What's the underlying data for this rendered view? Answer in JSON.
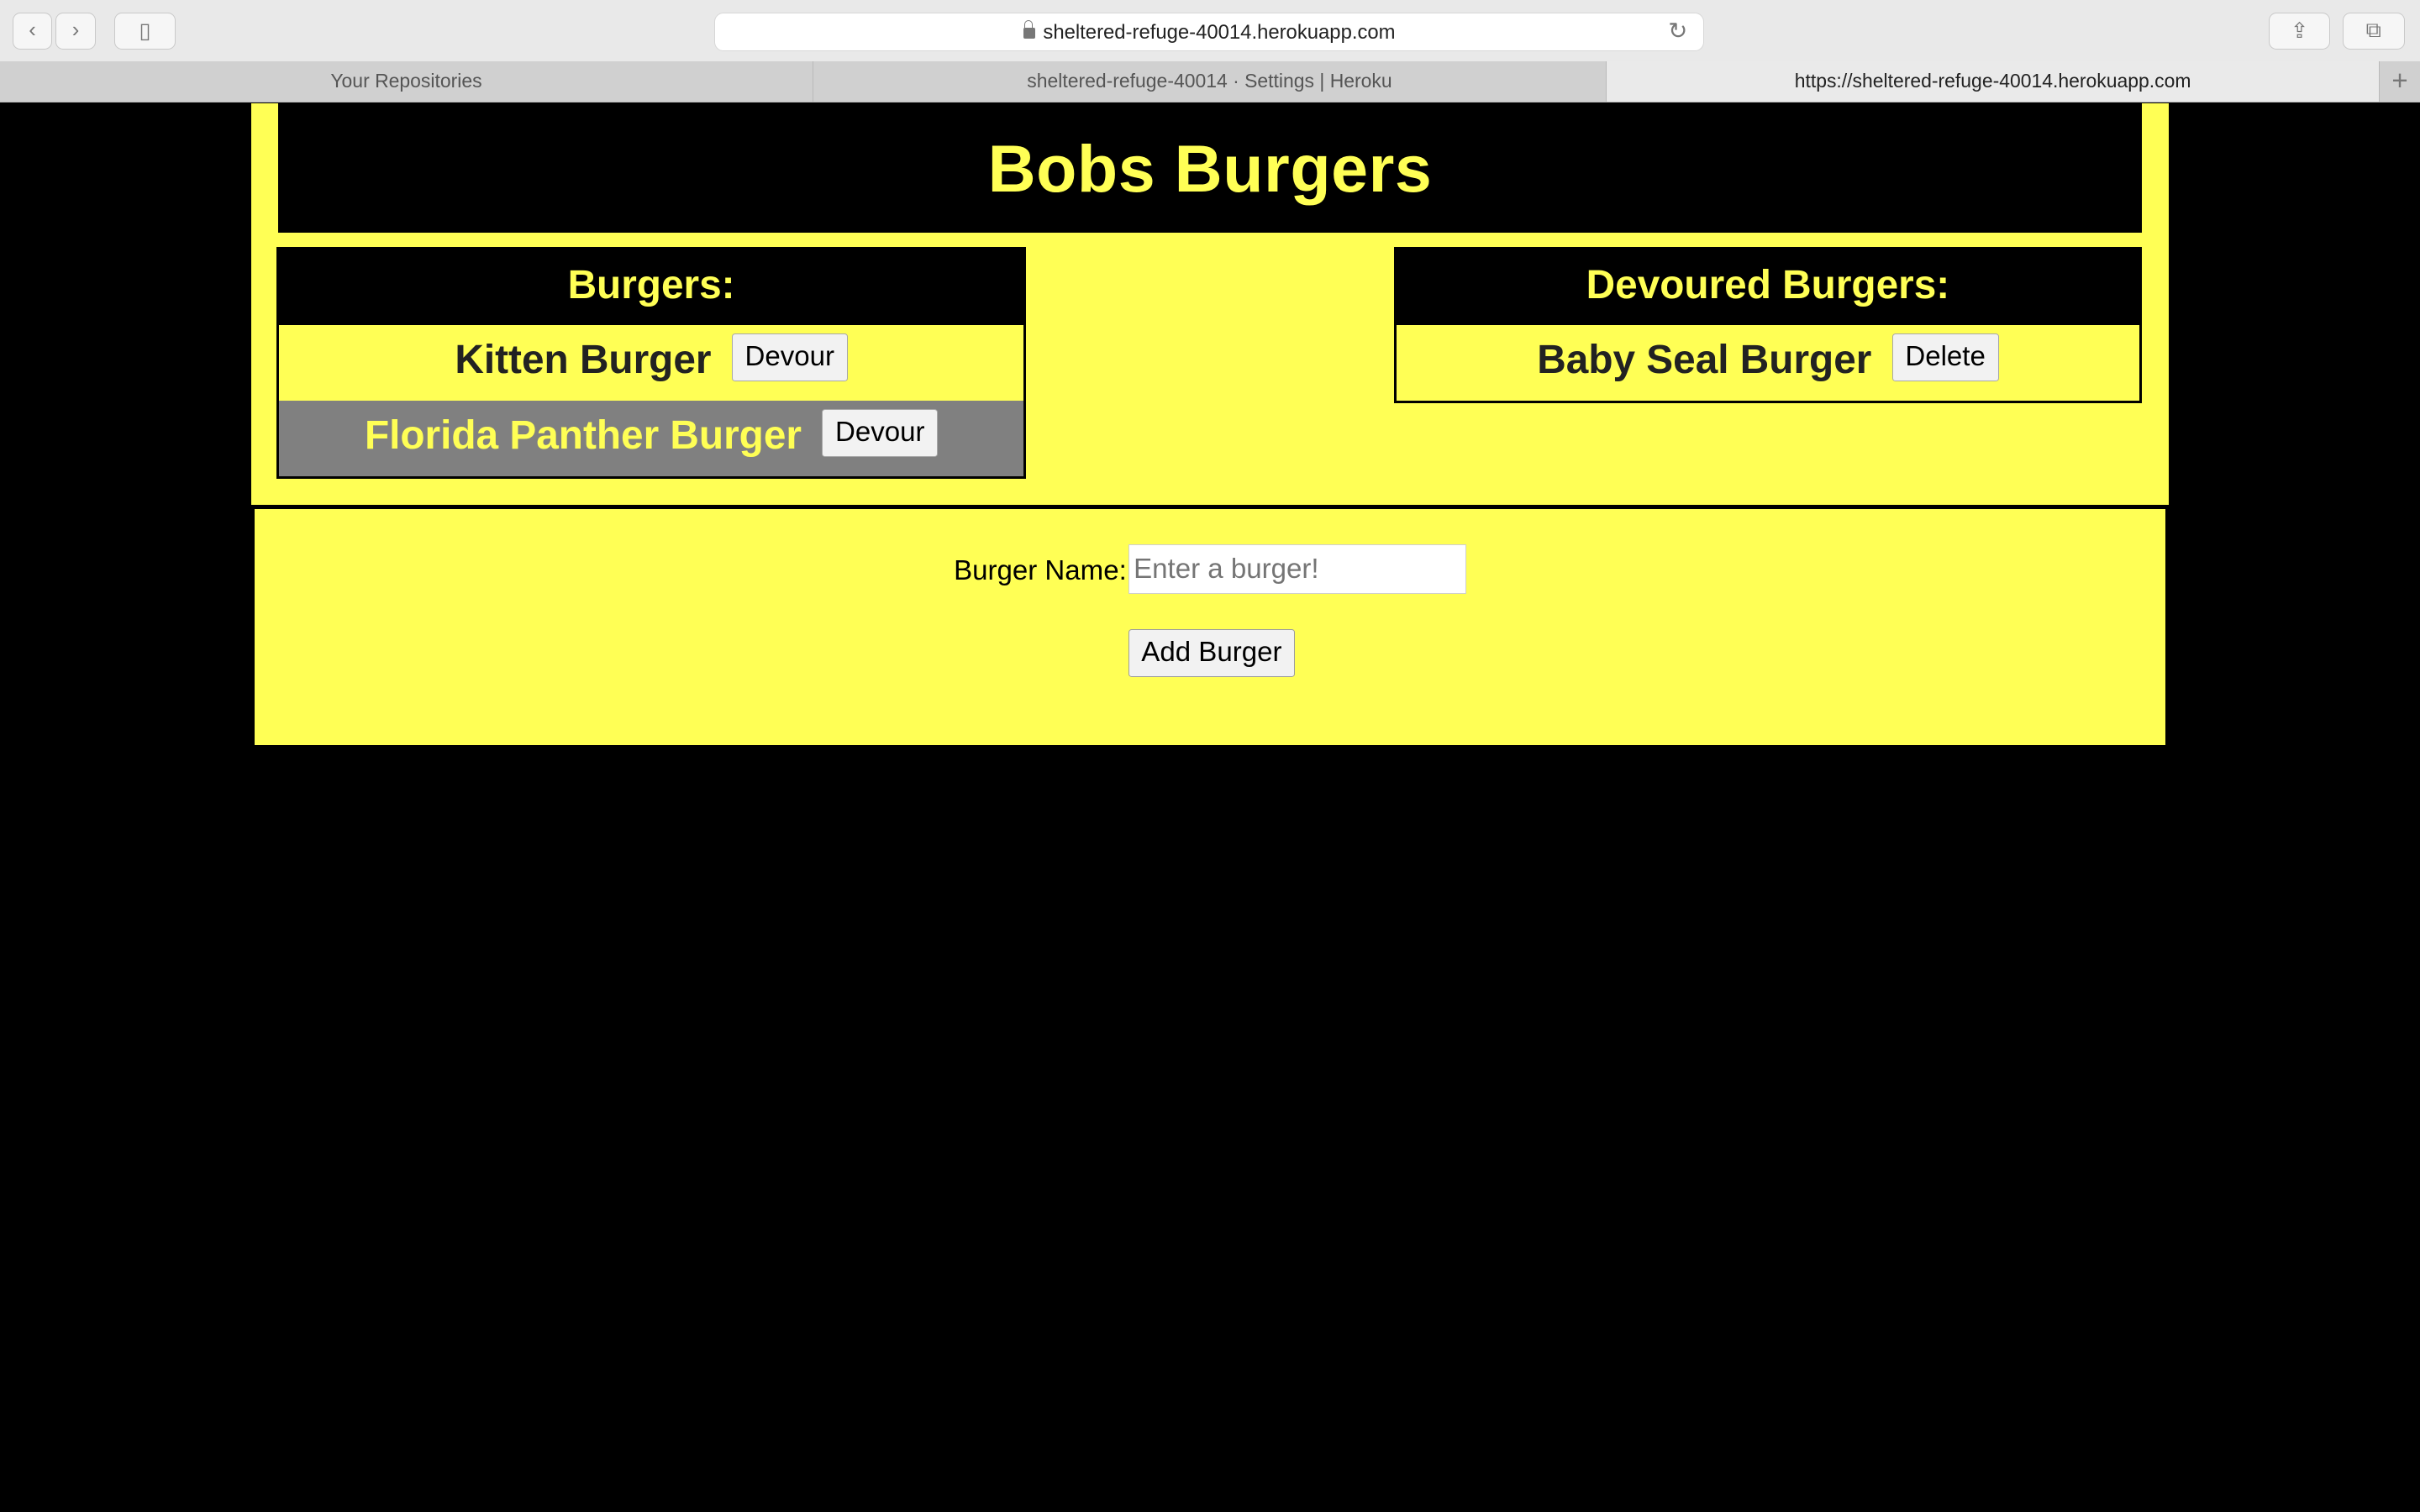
{
  "browser": {
    "url": "sheltered-refuge-40014.herokuapp.com",
    "tabs": [
      {
        "label": "Your Repositories"
      },
      {
        "label": "sheltered-refuge-40014 · Settings | Heroku"
      },
      {
        "label": "https://sheltered-refuge-40014.herokuapp.com"
      }
    ],
    "icons": {
      "back": "chevron-left-icon",
      "forward": "chevron-right-icon",
      "sidebar": "sidebar-icon",
      "reload": "reload-icon",
      "share": "share-icon",
      "tabs_overview": "tabs-icon",
      "new_tab": "plus-icon"
    }
  },
  "page": {
    "title": "Bobs Burgers",
    "burgers": {
      "heading": "Burgers:",
      "items": [
        {
          "name": "Kitten Burger",
          "button": "Devour"
        },
        {
          "name": "Florida Panther Burger",
          "button": "Devour"
        }
      ]
    },
    "devoured": {
      "heading": "Devoured Burgers:",
      "items": [
        {
          "name": "Baby Seal Burger",
          "button": "Delete"
        }
      ]
    },
    "form": {
      "label": "Burger Name:",
      "placeholder": "Enter a burger!",
      "submit": "Add Burger"
    }
  },
  "colors": {
    "accent": "#ffff55",
    "background": "#000000",
    "highlight_row": "#808080"
  }
}
